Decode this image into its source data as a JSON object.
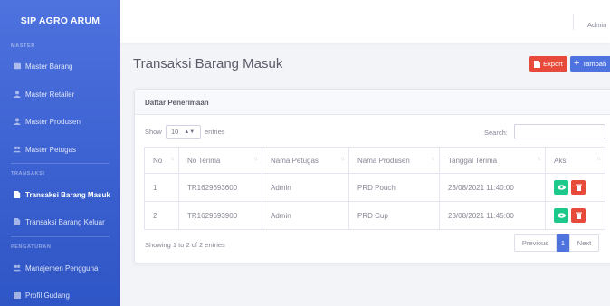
{
  "sidebar": {
    "brand": "SIP AGRO ARUM",
    "sections": {
      "master": "MASTER",
      "transaksi": "TRANSAKSI",
      "pengaturan": "PENGATURAN"
    },
    "items": [
      {
        "label": "Master Barang"
      },
      {
        "label": "Master Retailer"
      },
      {
        "label": "Master Produsen"
      },
      {
        "label": "Master Petugas"
      },
      {
        "label": "Transaksi Barang Masuk"
      },
      {
        "label": "Transaksi Barang Keluar"
      },
      {
        "label": "Manajemen Pengguna"
      },
      {
        "label": "Profil Gudang"
      }
    ]
  },
  "topbar": {
    "user": "Admin"
  },
  "page": {
    "title": "Transaksi Barang Masuk",
    "export_label": "Export",
    "add_label": "Tambah"
  },
  "card": {
    "title": "Daftar Penerimaan",
    "show_label": "Show",
    "show_value": "10",
    "entries_label": "entries",
    "search_label": "Search:",
    "columns": [
      "No",
      "No Terima",
      "Nama Petugas",
      "Nama Produsen",
      "Tanggal Terima",
      "Aksi"
    ],
    "rows": [
      {
        "no": "1",
        "no_terima": "TR1629693600",
        "petugas": "Admin",
        "produsen": "PRD Pouch",
        "tanggal": "23/08/2021 11:40:00"
      },
      {
        "no": "2",
        "no_terima": "TR1629693900",
        "petugas": "Admin",
        "produsen": "PRD Cup",
        "tanggal": "23/08/2021 11:45:00"
      }
    ],
    "info": "Showing 1 to 2 of 2 entries",
    "pagination": {
      "previous": "Previous",
      "current": "1",
      "next": "Next"
    }
  },
  "colors": {
    "primary": "#4e73df",
    "danger": "#e74a3b",
    "success": "#1cc88a"
  }
}
